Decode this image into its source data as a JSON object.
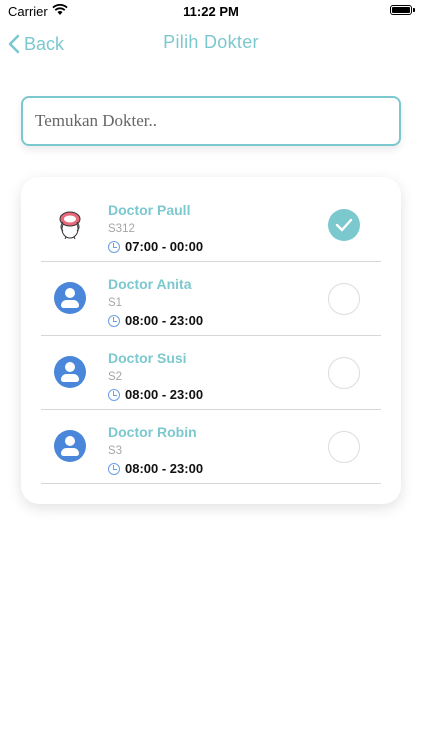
{
  "status_bar": {
    "carrier": "Carrier",
    "time": "11:22 PM"
  },
  "nav": {
    "back_label": "Back",
    "title": "Pilih Dokter"
  },
  "search": {
    "placeholder": "Temukan Dokter..",
    "value": ""
  },
  "colors": {
    "accent": "#7cc8cf",
    "avatar_blue": "#4a86d9",
    "clock_blue": "#6b9fe6",
    "code_gray": "#a6a6a6"
  },
  "doctors": [
    {
      "name": "Doctor Paull",
      "code": "S312",
      "hours": "07:00 - 00:00",
      "selected": true,
      "avatar": "cartoon-photo"
    },
    {
      "name": "Doctor Anita",
      "code": "S1",
      "hours": "08:00 - 23:00",
      "selected": false,
      "avatar": "user-icon"
    },
    {
      "name": "Doctor Susi",
      "code": "S2",
      "hours": "08:00 - 23:00",
      "selected": false,
      "avatar": "user-icon"
    },
    {
      "name": "Doctor Robin",
      "code": "S3",
      "hours": "08:00 - 23:00",
      "selected": false,
      "avatar": "user-icon"
    }
  ]
}
